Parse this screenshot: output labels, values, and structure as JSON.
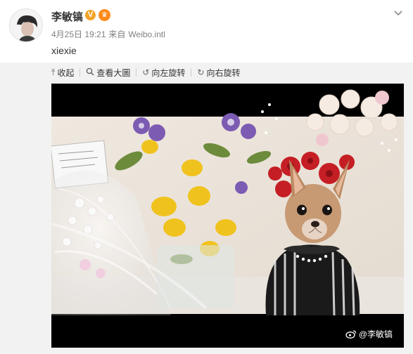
{
  "post": {
    "username": "李敏镐",
    "verified_badge": "V",
    "member_badge_icon": "crown-icon",
    "date": "4月25日 19:21",
    "source_prefix": "来自",
    "source": "Weibo.intl",
    "text": "xiexie",
    "more_icon": "chevron-down-icon"
  },
  "toolbar": {
    "collapse": "收起",
    "view_large": "查看大圖",
    "rotate_left": "向左旋转",
    "rotate_right": "向右旋转"
  },
  "photo": {
    "watermark": "@李敏镐"
  },
  "colors": {
    "verified_badge": "#f3a42a",
    "media_background": "#f2f2f2",
    "meta_text": "#808080"
  }
}
